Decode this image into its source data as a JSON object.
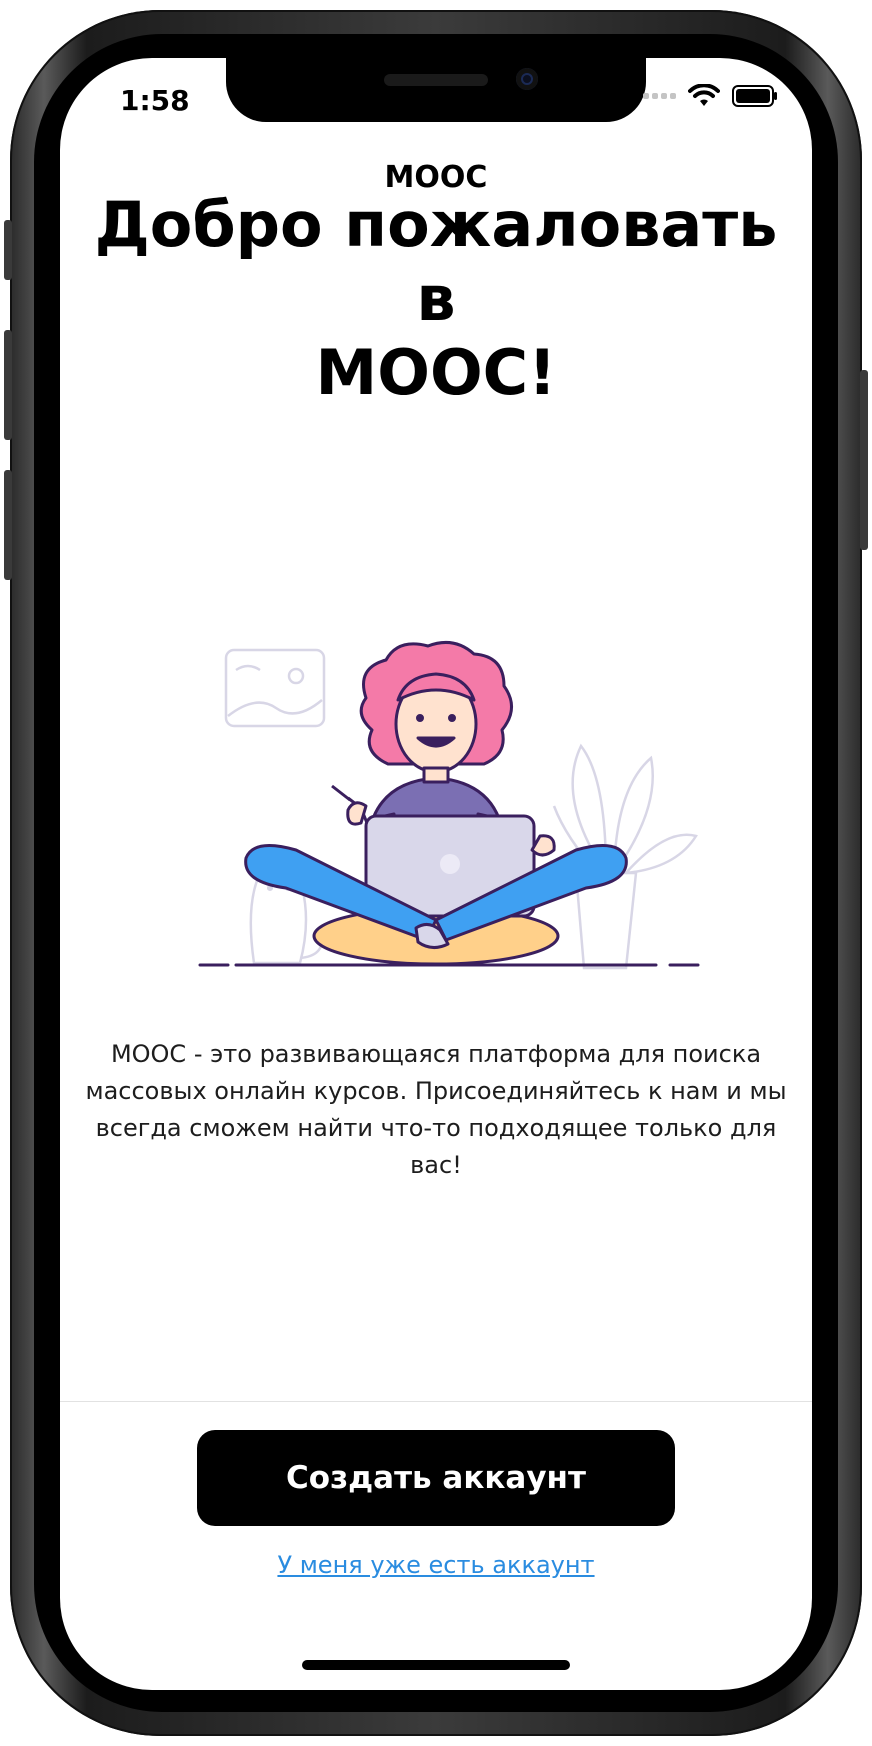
{
  "status_bar": {
    "time": "1:58"
  },
  "header": {
    "small_title": "MOOC",
    "welcome_title_line1": "Добро пожаловать",
    "welcome_title_line2": "в",
    "welcome_title_line3": "MOOC!"
  },
  "content": {
    "description": "MOOC - это развивающаяся платформа для поиска массовых онлайн курсов. Присоединяйтесь к нам и мы всегда сможем найти что-то подходящее только для вас!"
  },
  "actions": {
    "create_account_label": "Создать аккаунт",
    "have_account_label": "У меня уже есть аккаунт"
  },
  "colors": {
    "link": "#2a8ce0",
    "primary_button": "#000000",
    "hair": "#f47aa8",
    "shirt": "#7b6fb3",
    "pants": "#3fa0f2",
    "cushion": "#ffd08a"
  }
}
